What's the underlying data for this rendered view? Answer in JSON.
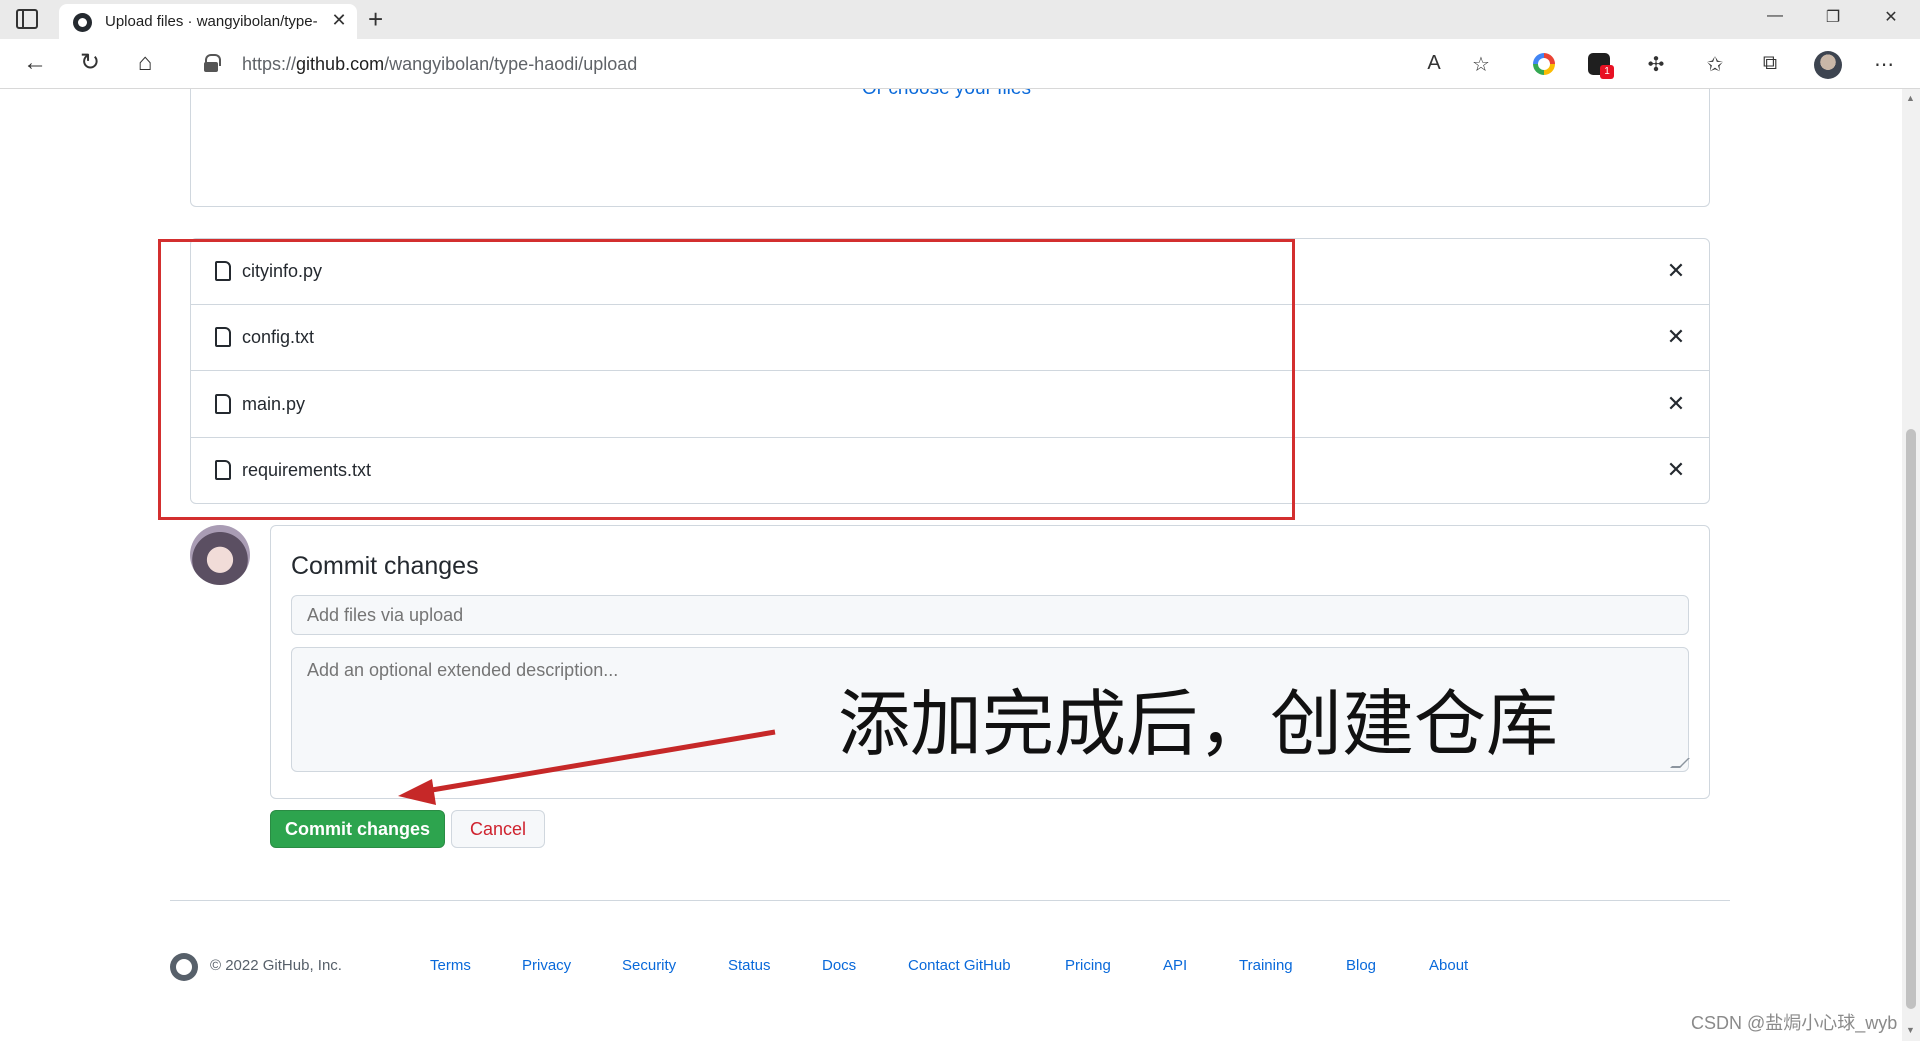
{
  "browser": {
    "tab_title": "Upload files · wangyibolan/type-",
    "url_prefix": "https://",
    "url_domain": "github.com",
    "url_path": "/wangyibolan/type-haodi/upload",
    "badge_count": "1"
  },
  "upload": {
    "choose_files_text": "Or choose your files",
    "files": [
      {
        "name": "cityinfo.py"
      },
      {
        "name": "config.txt"
      },
      {
        "name": "main.py"
      },
      {
        "name": "requirements.txt"
      }
    ]
  },
  "commit": {
    "title": "Commit changes",
    "summary_placeholder": "Add files via upload",
    "description_placeholder": "Add an optional extended description...",
    "commit_button": "Commit changes",
    "cancel_button": "Cancel"
  },
  "annotation": {
    "text": "添加完成后，创建仓库",
    "color": "#d32f2f"
  },
  "footer": {
    "copyright": "© 2022 GitHub, Inc.",
    "links": [
      "Terms",
      "Privacy",
      "Security",
      "Status",
      "Docs",
      "Contact GitHub",
      "Pricing",
      "API",
      "Training",
      "Blog",
      "About"
    ]
  },
  "watermark": "CSDN @盐焗小心球_wyb",
  "colors": {
    "accent": "#0969da",
    "commit_button": "#2da44e",
    "cancel_text": "#cf222e"
  }
}
